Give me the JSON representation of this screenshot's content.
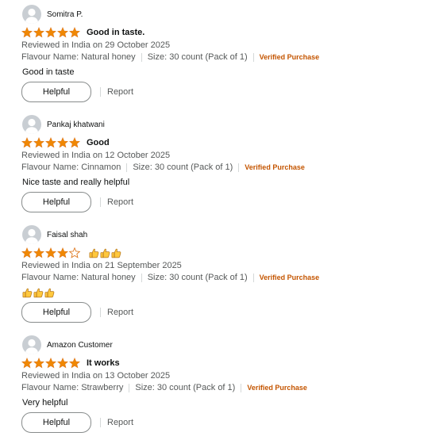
{
  "colors": {
    "star": "#f08804",
    "star_empty_outline": "#de7921",
    "verified": "#c45500",
    "muted_text": "#565959",
    "avatar_bg": "#c9ced3"
  },
  "icons": {
    "avatar": "user-avatar-icon",
    "star_full": "star-full-icon",
    "star_empty": "star-empty-icon",
    "thumbs_up": "thumbs-up-emoji-icon"
  },
  "reviews": [
    {
      "reviewer": "Somitra P.",
      "rating": 5,
      "title": "Good in taste.",
      "date_line": "Reviewed in India on 29 October 2025",
      "flavour": "Flavour Name: Natural honey",
      "size": "Size: 30 count (Pack of 1)",
      "verified": "Verified Purchase",
      "body": "Good in taste",
      "helpful_label": "Helpful",
      "report_label": "Report"
    },
    {
      "reviewer": "Pankaj khatwani",
      "rating": 5,
      "title": "Good",
      "date_line": "Reviewed in India on 12 October 2025",
      "flavour": "Flavour Name: Cinnamon",
      "size": "Size: 30 count (Pack of 1)",
      "verified": "Verified Purchase",
      "body": "Nice taste and really helpful",
      "helpful_label": "Helpful",
      "report_label": "Report"
    },
    {
      "reviewer": "Faisal shah",
      "rating": 4,
      "title": "👍👍👍",
      "date_line": "Reviewed in India on 21 September 2025",
      "flavour": "Flavour Name: Natural honey",
      "size": "Size: 30 count (Pack of 1)",
      "verified": "Verified Purchase",
      "body": "👍👍👍",
      "helpful_label": "Helpful",
      "report_label": "Report"
    },
    {
      "reviewer": "Amazon Customer",
      "rating": 5,
      "title": "It works",
      "date_line": "Reviewed in India on 13 October 2025",
      "flavour": "Flavour Name: Strawberry",
      "size": "Size: 30 count (Pack of 1)",
      "verified": "Verified Purchase",
      "body": "Very helpful",
      "helpful_label": "Helpful",
      "report_label": "Report"
    }
  ]
}
